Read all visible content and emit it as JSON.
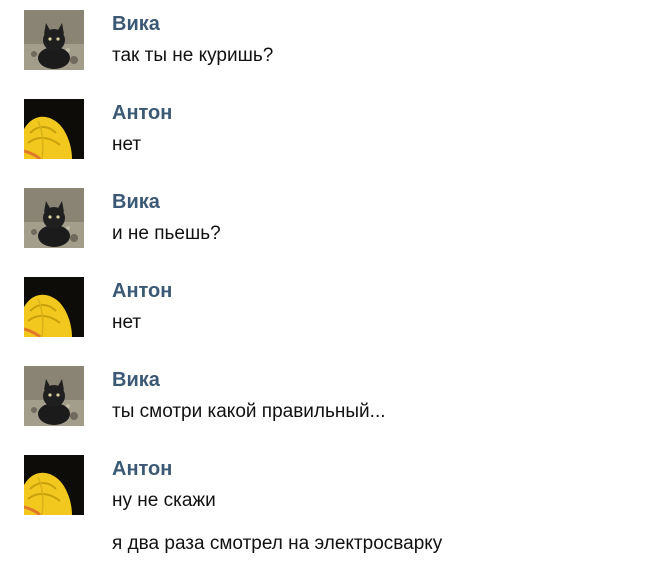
{
  "messages": [
    {
      "author": "Вика",
      "avatar_icon": "cat-avatar-icon",
      "text": "так ты не куришь?"
    },
    {
      "author": "Антон",
      "avatar_icon": "yellow-hat-avatar-icon",
      "text": "нет"
    },
    {
      "author": "Вика",
      "avatar_icon": "cat-avatar-icon",
      "text": "и не пьешь?"
    },
    {
      "author": "Антон",
      "avatar_icon": "yellow-hat-avatar-icon",
      "text": "нет"
    },
    {
      "author": "Вика",
      "avatar_icon": "cat-avatar-icon",
      "text": "ты смотри какой правильный..."
    },
    {
      "author": "Антон",
      "avatar_icon": "yellow-hat-avatar-icon",
      "text": "ну не скажи",
      "extra_text": "я два раза смотрел на электросварку"
    }
  ],
  "colors": {
    "author_name": "#3b5875",
    "message_text": "#111111",
    "background": "#ffffff"
  }
}
